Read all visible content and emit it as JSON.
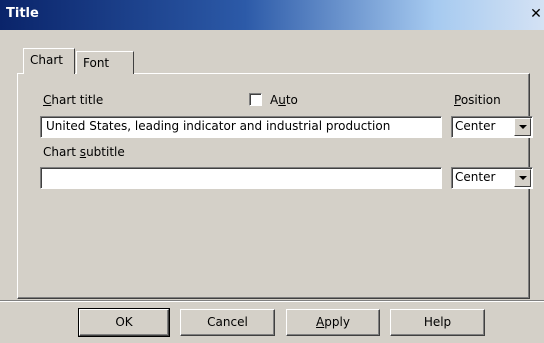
{
  "window": {
    "title": "Title",
    "close_glyph": "✕"
  },
  "tabs": [
    {
      "label": "Chart"
    },
    {
      "label": "Font"
    }
  ],
  "chart_tab": {
    "title_label_accel": "C",
    "title_label_rest": "hart title",
    "auto_checked": false,
    "auto_label_pre": "A",
    "auto_label_accel": "u",
    "auto_label_post": "to",
    "position_label_accel": "P",
    "position_label_rest": "osition",
    "title_value": "United States, leading indicator and industrial production",
    "title_position": "Center",
    "subtitle_label_pre": "Chart ",
    "subtitle_label_accel": "s",
    "subtitle_label_rest": "ubtitle",
    "subtitle_value": "",
    "subtitle_position": "Center"
  },
  "buttons": {
    "ok": "OK",
    "cancel": "Cancel",
    "apply_accel": "A",
    "apply_rest": "pply",
    "help": "Help"
  }
}
